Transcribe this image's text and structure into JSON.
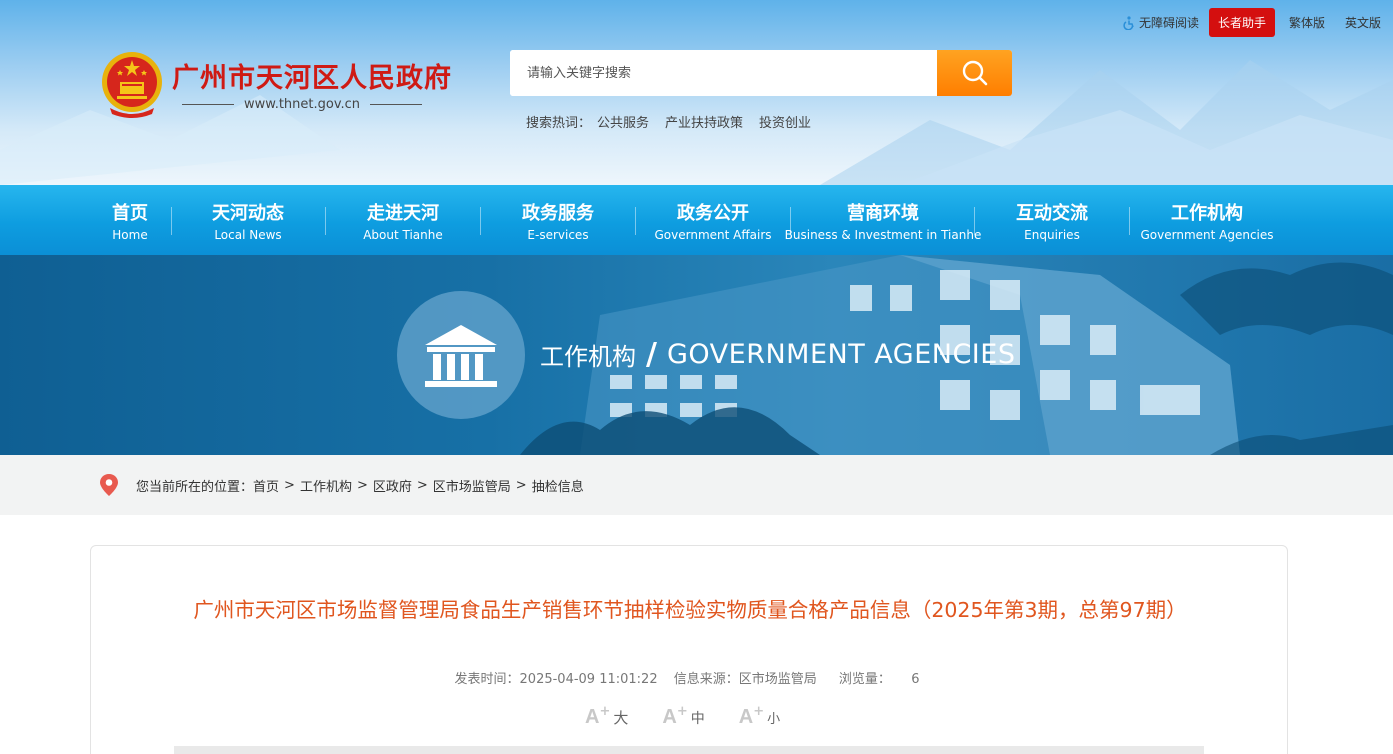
{
  "top_links": {
    "accessibility": "无障碍阅读",
    "elder": "长者助手",
    "traditional": "繁体版",
    "english": "英文版"
  },
  "logo": {
    "title": "广州市天河区人民政府",
    "url": "www.thnet.gov.cn"
  },
  "search": {
    "placeholder": "请输入关键字搜索",
    "hot_label": "搜索热词：",
    "hot_words": [
      "公共服务",
      "产业扶持政策",
      "投资创业"
    ]
  },
  "nav": [
    {
      "cn": "首页",
      "en": "Home"
    },
    {
      "cn": "天河动态",
      "en": "Local News"
    },
    {
      "cn": "走进天河",
      "en": "About Tianhe"
    },
    {
      "cn": "政务服务",
      "en": "E-services"
    },
    {
      "cn": "政务公开",
      "en": "Government Affairs"
    },
    {
      "cn": "营商环境",
      "en": "Business & Investment in Tianhe"
    },
    {
      "cn": "互动交流",
      "en": "Enquiries"
    },
    {
      "cn": "工作机构",
      "en": "Government Agencies"
    }
  ],
  "banner": {
    "cn": "工作机构",
    "slash": "/",
    "en": "GOVERNMENT AGENCIES"
  },
  "breadcrumb": {
    "prefix": "您当前所在的位置：",
    "items": [
      "首页",
      "工作机构",
      "区政府",
      "区市场监管局",
      "抽检信息"
    ],
    "separator": ">"
  },
  "article": {
    "title": "广州市天河区市场监督管理局食品生产销售环节抽样检验实物质量合格产品信息（2025年第3期，总第97期）",
    "publish_time": "发表时间：2025-04-09 11:01:22",
    "source": "信息来源：区市场监管局",
    "views_label": "浏览量：",
    "views": "6",
    "font_sizes": [
      "大",
      "中",
      "小"
    ]
  },
  "colors": {
    "brand_red": "#cf1a14",
    "nav_blue": "#0e9de0",
    "search_orange": "#ff8a0c",
    "title_orange": "#e0561f",
    "elder_red": "#d40f0f"
  }
}
